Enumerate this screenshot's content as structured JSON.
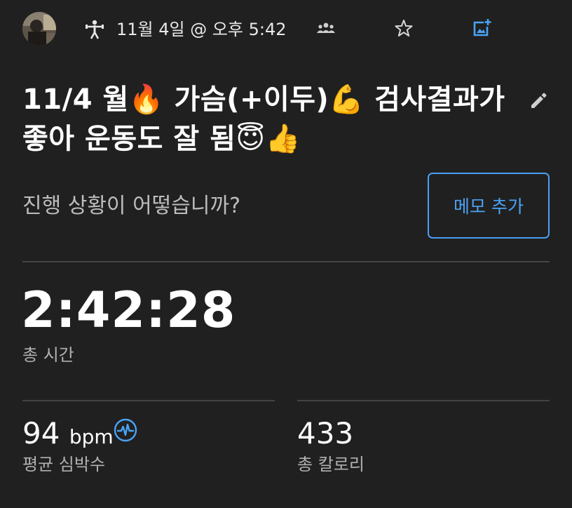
{
  "header": {
    "date_text": "11월 4일 @ 오후 5:42",
    "icons": {
      "activity": "strength-training-icon",
      "people": "people-icon",
      "star": "star-outline-icon",
      "photo": "add-photo-icon"
    }
  },
  "activity": {
    "title": "11/4 월🔥 가슴(+이두)💪 검사결과가 좋아 운동도 잘 됨😇👍",
    "prompt": "진행 상황이 어떻습니까?",
    "memo_button": "메모 추가"
  },
  "stats": {
    "total_time": {
      "value": "2:42:28",
      "label": "총 시간"
    },
    "heart_rate": {
      "value": "94",
      "unit": "bpm",
      "label": "평균 심박수"
    },
    "calories": {
      "value": "433",
      "label": "총 칼로리"
    }
  },
  "colors": {
    "background": "#202020",
    "accent": "#4aa3f5",
    "divider": "#444444",
    "secondary_text": "#b0b0b0"
  }
}
